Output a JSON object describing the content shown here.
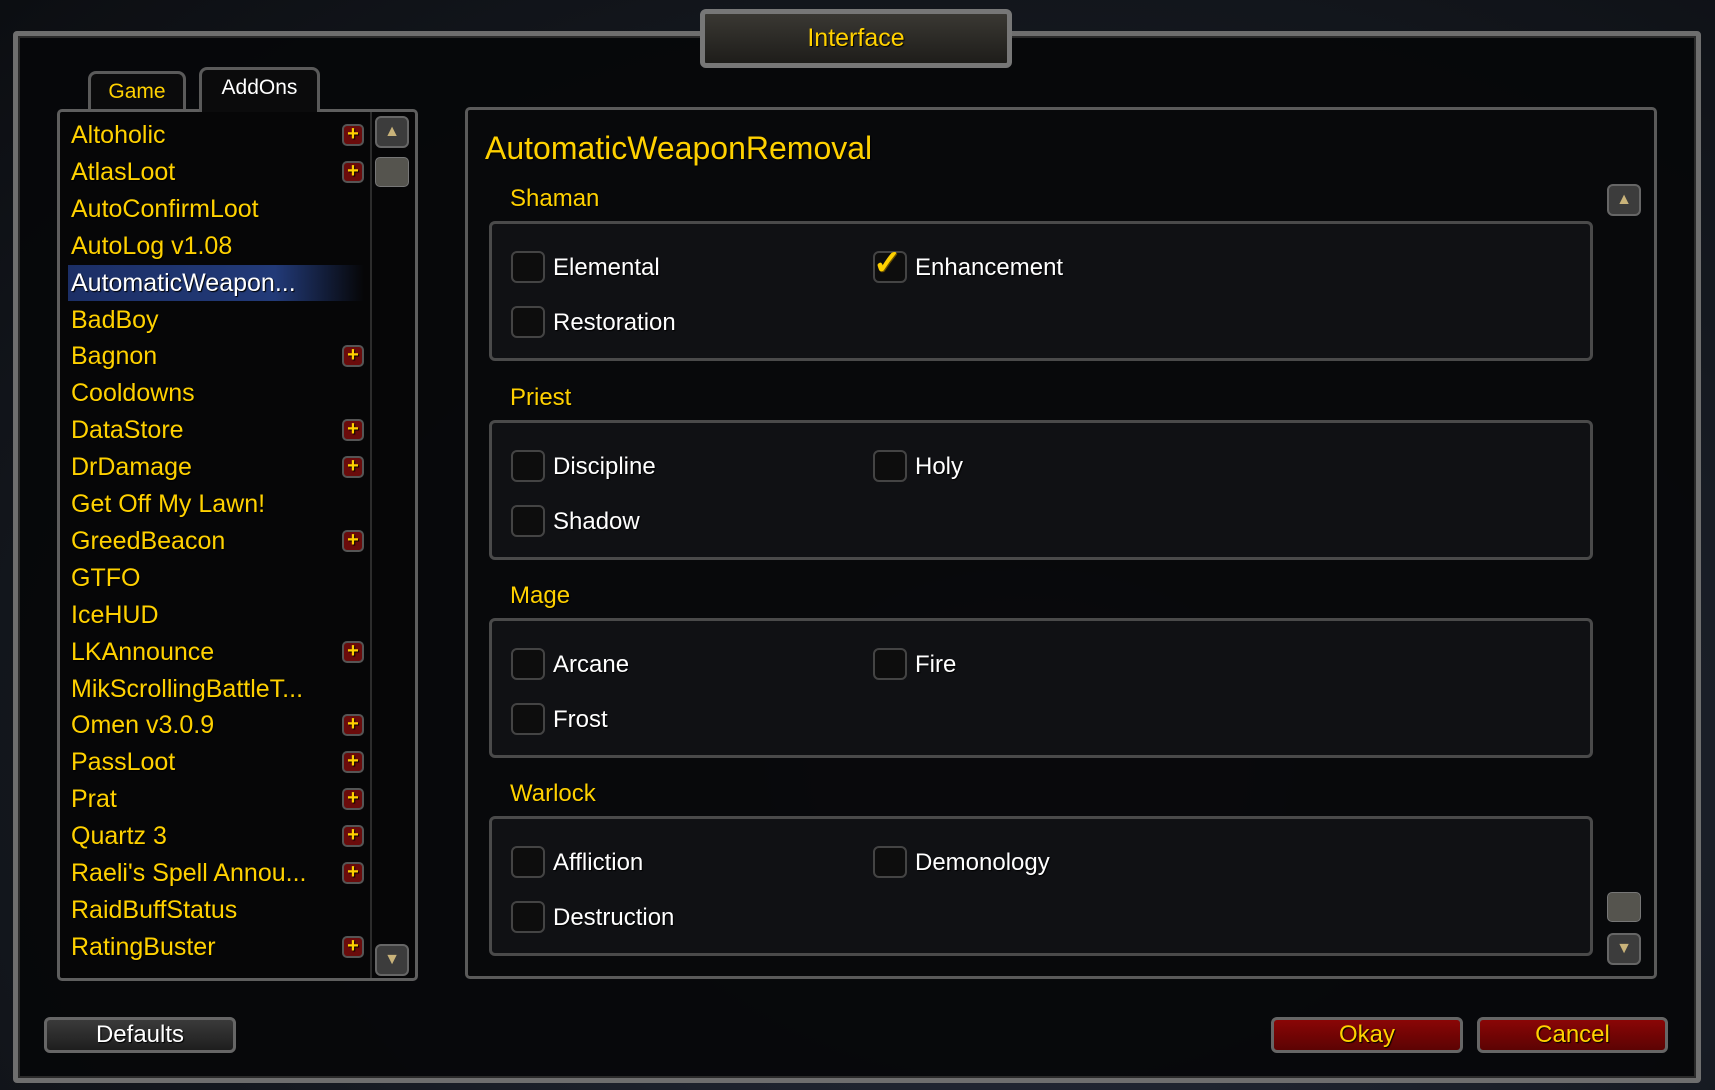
{
  "window": {
    "title": "Interface"
  },
  "tabs": [
    {
      "label": "Game",
      "active": false
    },
    {
      "label": "AddOns",
      "active": true
    }
  ],
  "addons": [
    {
      "label": "Altoholic",
      "expandable": true
    },
    {
      "label": "AtlasLoot",
      "expandable": true
    },
    {
      "label": "AutoConfirmLoot",
      "expandable": false
    },
    {
      "label": "AutoLog v1.08",
      "expandable": false
    },
    {
      "label": "AutomaticWeapon...",
      "expandable": false,
      "selected": true
    },
    {
      "label": "BadBoy",
      "expandable": false
    },
    {
      "label": "Bagnon",
      "expandable": true
    },
    {
      "label": "Cooldowns",
      "expandable": false
    },
    {
      "label": "DataStore",
      "expandable": true
    },
    {
      "label": "DrDamage",
      "expandable": true
    },
    {
      "label": "Get Off My Lawn!",
      "expandable": false
    },
    {
      "label": "GreedBeacon",
      "expandable": true
    },
    {
      "label": "GTFO",
      "expandable": false
    },
    {
      "label": "IceHUD",
      "expandable": false
    },
    {
      "label": "LKAnnounce",
      "expandable": true
    },
    {
      "label": "MikScrollingBattleT...",
      "expandable": false
    },
    {
      "label": "Omen v3.0.9",
      "expandable": true
    },
    {
      "label": "PassLoot",
      "expandable": true
    },
    {
      "label": "Prat",
      "expandable": true
    },
    {
      "label": "Quartz 3",
      "expandable": true
    },
    {
      "label": "Raeli's Spell Annou...",
      "expandable": true
    },
    {
      "label": "RaidBuffStatus",
      "expandable": false
    },
    {
      "label": "RatingBuster",
      "expandable": true
    }
  ],
  "panel": {
    "title": "AutomaticWeaponRemoval",
    "sections": [
      {
        "name": "Shaman",
        "options": [
          {
            "label": "Elemental",
            "checked": false
          },
          {
            "label": "Enhancement",
            "checked": true
          },
          {
            "label": "Restoration",
            "checked": false
          }
        ]
      },
      {
        "name": "Priest",
        "options": [
          {
            "label": "Discipline",
            "checked": false
          },
          {
            "label": "Holy",
            "checked": false
          },
          {
            "label": "Shadow",
            "checked": false
          }
        ]
      },
      {
        "name": "Mage",
        "options": [
          {
            "label": "Arcane",
            "checked": false
          },
          {
            "label": "Fire",
            "checked": false
          },
          {
            "label": "Frost",
            "checked": false
          }
        ]
      },
      {
        "name": "Warlock",
        "options": [
          {
            "label": "Affliction",
            "checked": false
          },
          {
            "label": "Demonology",
            "checked": false
          },
          {
            "label": "Destruction",
            "checked": false
          }
        ]
      }
    ]
  },
  "buttons": {
    "defaults": "Defaults",
    "okay": "Okay",
    "cancel": "Cancel"
  },
  "colors": {
    "gold": "#ffd100",
    "selected": "#223a78",
    "button_red": "#8a0606"
  }
}
